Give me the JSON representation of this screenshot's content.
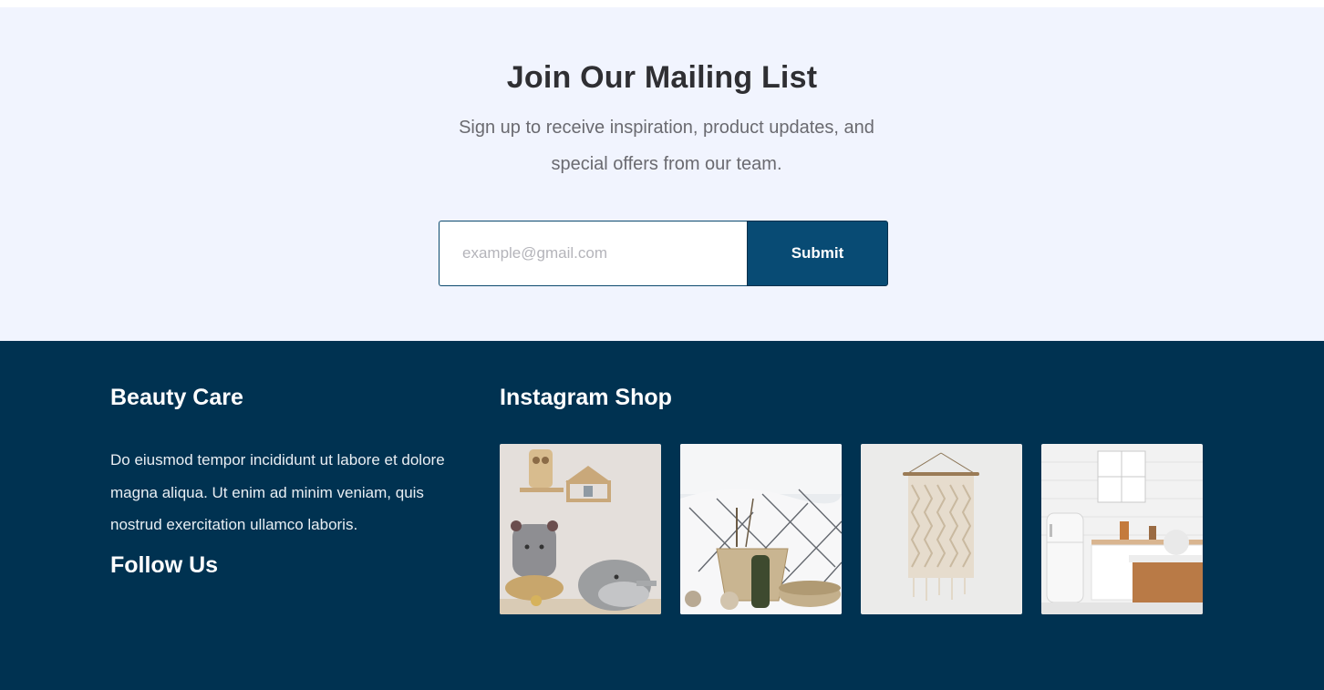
{
  "newsletter": {
    "title": "Join Our Mailing List",
    "subtitle": "Sign up to receive inspiration, product updates, and special offers from our team.",
    "email_placeholder": "example@gmail.com",
    "submit_label": "Submit"
  },
  "footer": {
    "brand_title": "Beauty Care",
    "brand_description": "Do eiusmod tempor incididunt ut labore et dolore magna aliqua. Ut enim ad minim veniam, quis nostrud exercitation ullamco laboris.",
    "follow_title": "Follow Us",
    "instagram_title": "Instagram Shop",
    "instagram_images": [
      {
        "name": "kids-shelf-toys-photo"
      },
      {
        "name": "bedroom-baskets-photo"
      },
      {
        "name": "macrame-wall-hanging-photo"
      },
      {
        "name": "white-kitchen-photo"
      }
    ]
  },
  "colors": {
    "newsletter_bg": "#f1f4fe",
    "footer_bg": "#003251",
    "button_bg": "#084b74",
    "heading_text": "#2f2f33"
  }
}
